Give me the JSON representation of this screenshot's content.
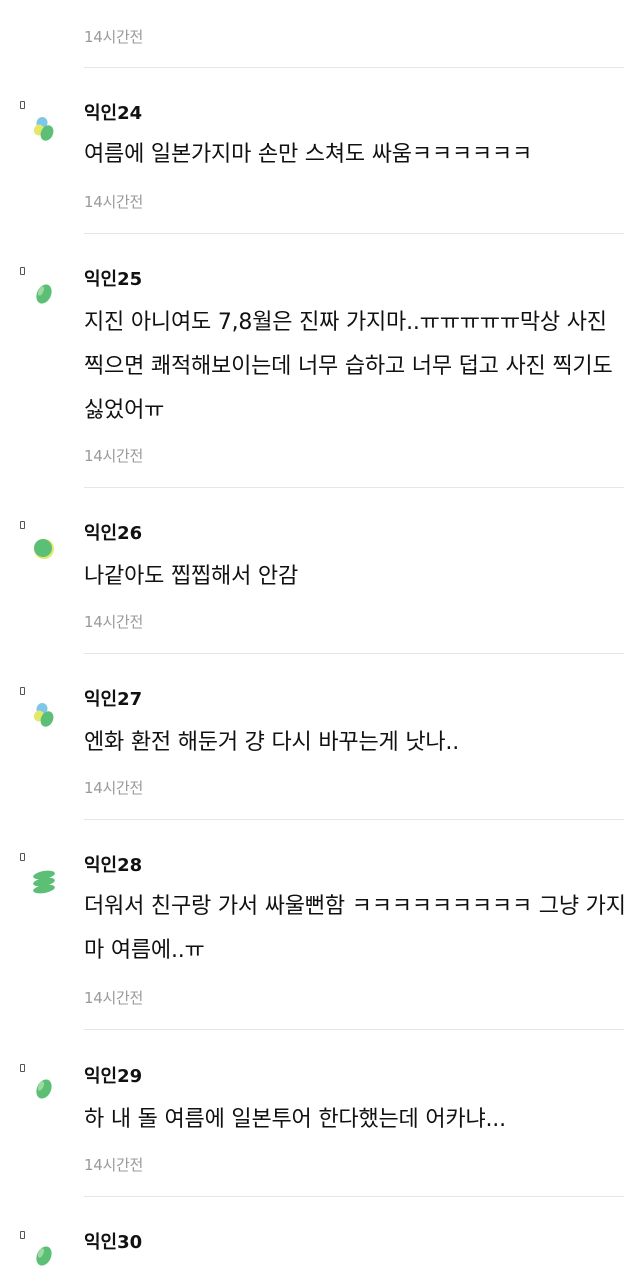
{
  "comments": [
    {
      "author": "",
      "text": "",
      "time": "14시간전",
      "avatar": "none"
    },
    {
      "author": "익인24",
      "text": "여름에 일본가지마 손만 스쳐도 싸움ㅋㅋㅋㅋㅋㅋ",
      "time": "14시간전",
      "avatar": "multi-dot"
    },
    {
      "author": "익인25",
      "text": "지진 아니여도 7,8월은 진짜 가지마..ㅠㅠㅠㅠㅠ막상 사진 찍으면 쾌적해보이는데 너무 습하고 너무 덥고 사진 찍기도 싫었어ㅠ",
      "time": "14시간전",
      "avatar": "single-green"
    },
    {
      "author": "익인26",
      "text": "나같아도 찝찝해서 안감",
      "time": "14시간전",
      "avatar": "green-yellow"
    },
    {
      "author": "익인27",
      "text": "엔화 환전 해둔거 걍 다시 바꾸는게 낫나..",
      "time": "14시간전",
      "avatar": "multi-dot"
    },
    {
      "author": "익인28",
      "text": "더워서 친구랑 가서 싸울뻔함 ㅋㅋㅋㅋㅋㅋㅋㅋㅋ 그냥 가지마 여름에..ㅠ",
      "time": "14시간전",
      "avatar": "stack"
    },
    {
      "author": "익인29",
      "text": "하 내 돌 여름에 일본투어 한다했는데 어카냐...",
      "time": "14시간전",
      "avatar": "single-green"
    },
    {
      "author": "익인30",
      "text": "",
      "time": "",
      "avatar": "single-green"
    }
  ],
  "colors": {
    "avatar_green": "#5cbf76",
    "avatar_light_green": "#9ed9a4",
    "avatar_blue": "#7fc7e8",
    "avatar_yellow": "#e3e86a",
    "time_gray": "#9a9a9a",
    "divider": "#e6e6e6"
  }
}
